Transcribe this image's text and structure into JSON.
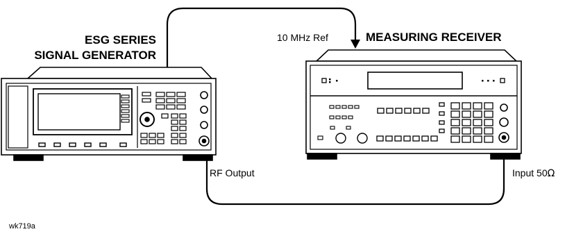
{
  "signal_generator": {
    "title_line1": "ESG SERIES",
    "title_line2": "SIGNAL GENERATOR"
  },
  "measuring_receiver": {
    "title": "MEASURING RECEIVER"
  },
  "connections": {
    "ref_label": "10 MHz Ref",
    "rf_output_label": "RF Output",
    "input_label": "Input 50",
    "input_unit_symbol": "Ω"
  },
  "figure_id": "wk719a"
}
